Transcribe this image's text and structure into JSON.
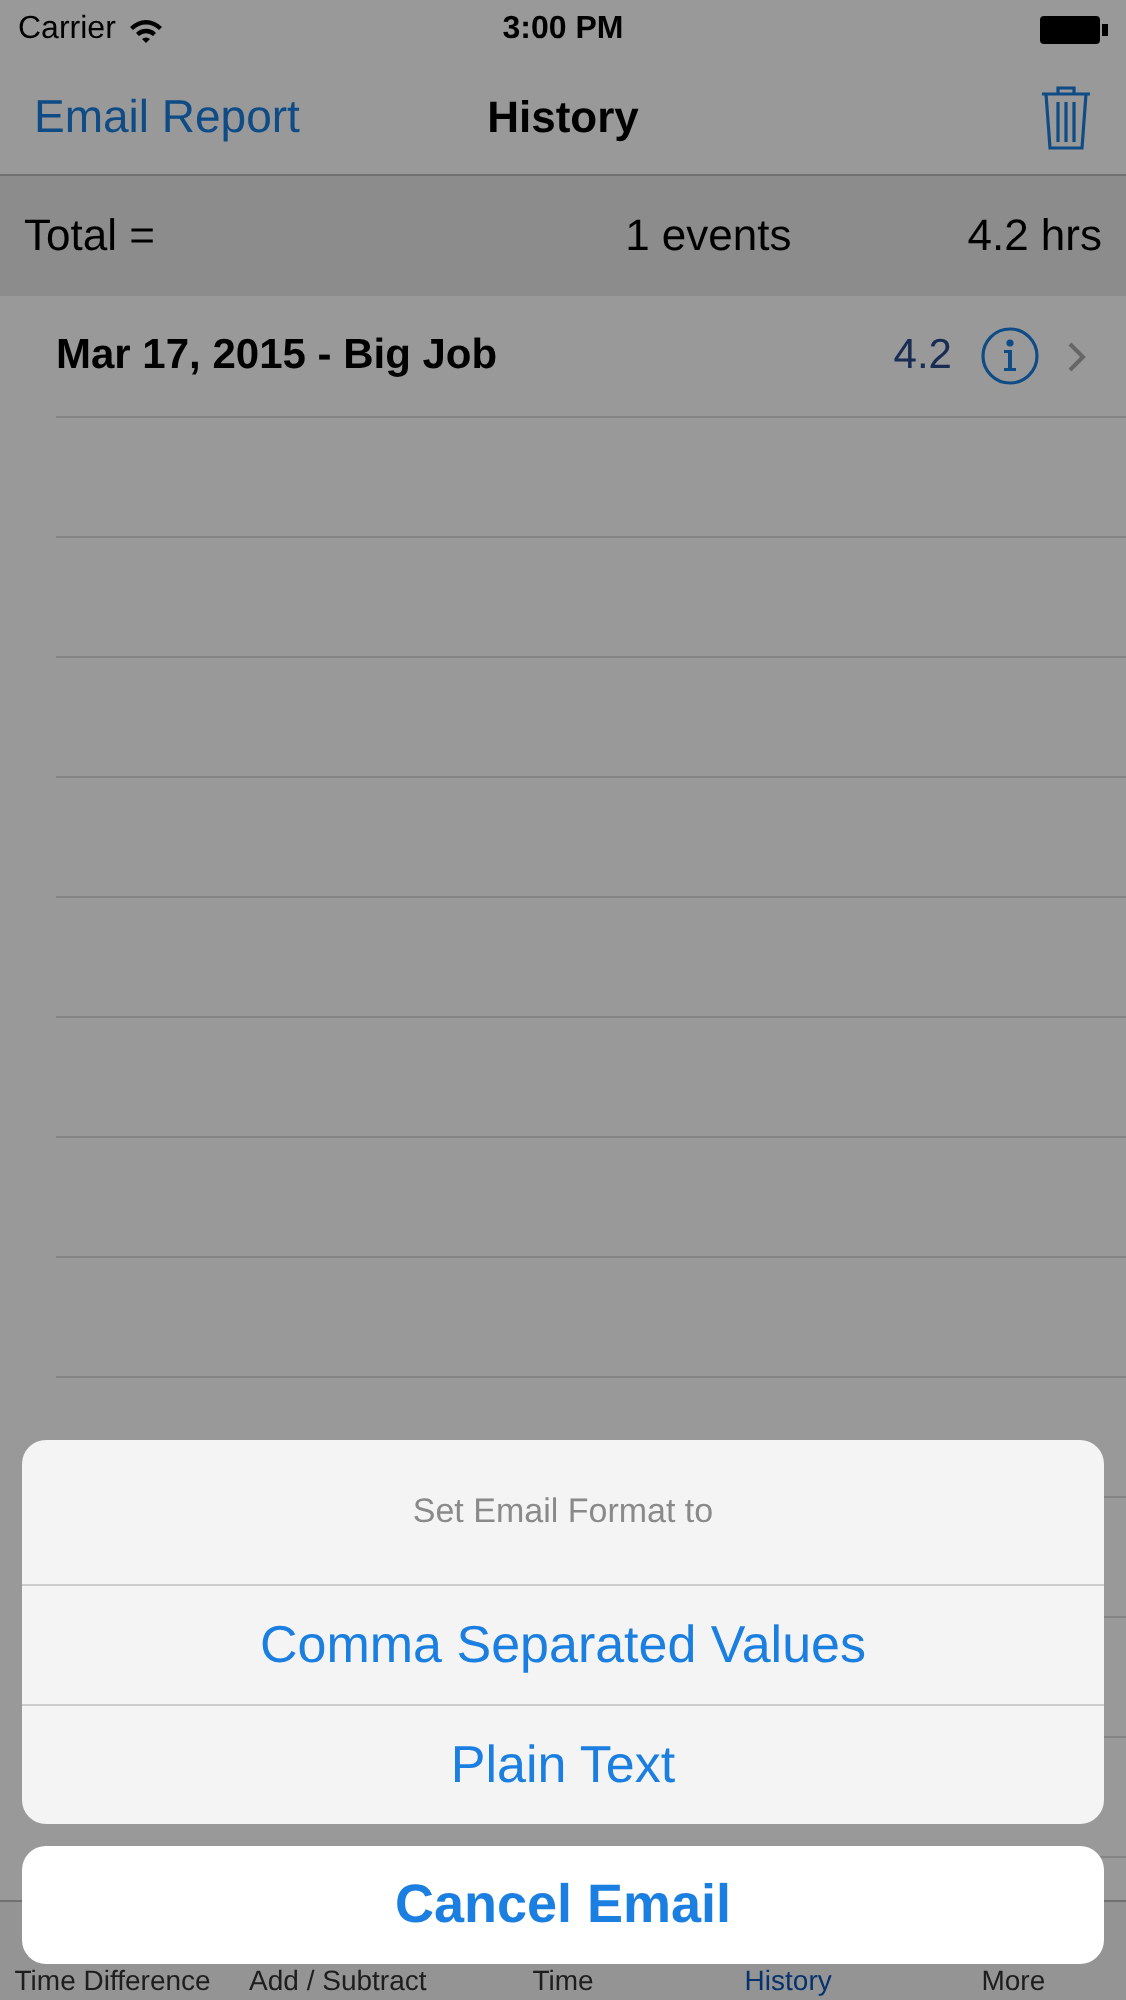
{
  "status_bar": {
    "carrier": "Carrier",
    "time": "3:00 PM"
  },
  "nav_bar": {
    "left_button": "Email Report",
    "title": "History"
  },
  "summary": {
    "label": "Total =",
    "events": "1 events",
    "hours": "4.2 hrs"
  },
  "rows": [
    {
      "title": "Mar 17, 2015 - Big Job",
      "value": "4.2"
    }
  ],
  "tab_bar": [
    {
      "label": "Time Difference",
      "selected": false
    },
    {
      "label": "Add / Subtract",
      "selected": false
    },
    {
      "label": "Time",
      "selected": false
    },
    {
      "label": "History",
      "selected": true
    },
    {
      "label": "More",
      "selected": false
    }
  ],
  "action_sheet": {
    "title": "Set Email Format to",
    "options": [
      "Comma Separated Values",
      "Plain Text"
    ],
    "cancel": "Cancel Email"
  }
}
